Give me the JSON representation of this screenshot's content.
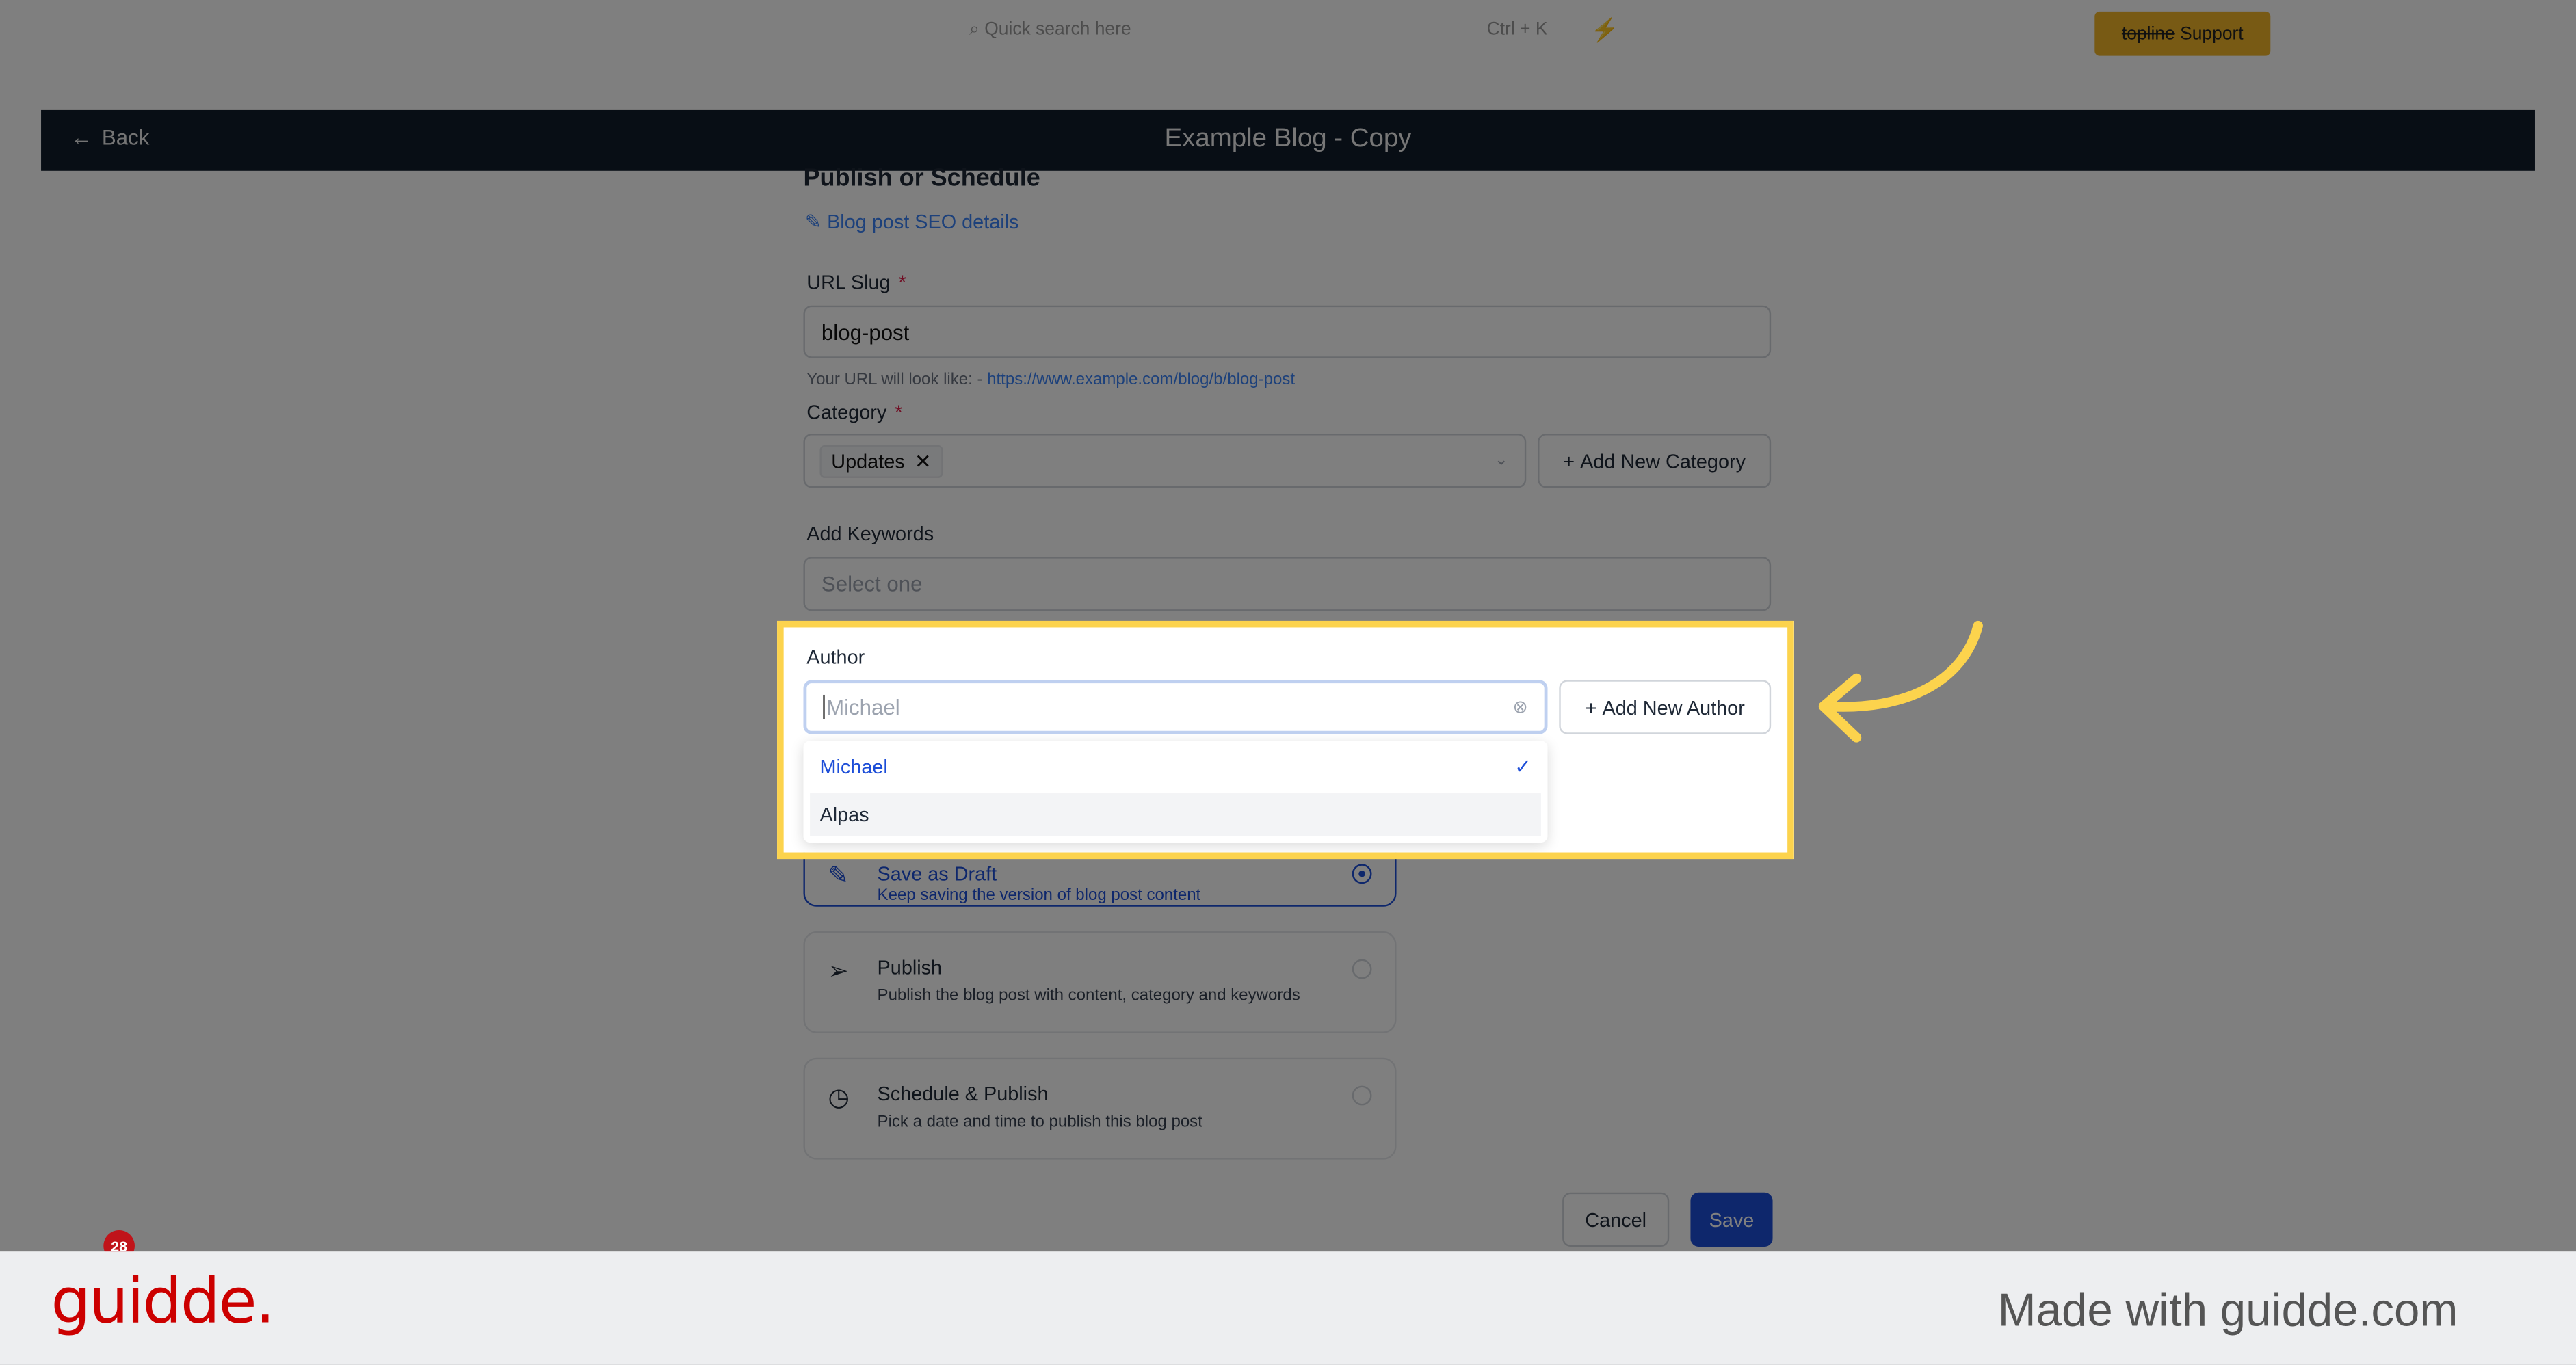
{
  "topbar": {
    "search_placeholder": "Quick search here",
    "shortcut": "Ctrl + K",
    "support_brand": "topline",
    "support_label": "Support"
  },
  "header": {
    "back_label": "Back",
    "title": "Example Blog - Copy"
  },
  "form": {
    "section_title": "Publish or Schedule",
    "seo_link": "Blog post SEO details",
    "url_slug": {
      "label": "URL Slug",
      "required": "*",
      "value": "blog-post",
      "hint": "Your URL will look like: -",
      "hint_url": "https://www.example.com/blog/b/blog-post"
    },
    "category": {
      "label": "Category",
      "required": "*",
      "tags": [
        "Updates"
      ],
      "add_button": "Add New Category"
    },
    "keywords": {
      "label": "Add Keywords",
      "placeholder": "Select one"
    },
    "author": {
      "label": "Author",
      "placeholder": "Michael",
      "add_button": "Add New Author",
      "options": [
        {
          "label": "Michael",
          "selected": true
        },
        {
          "label": "Alpas",
          "selected": false
        }
      ]
    }
  },
  "publish_options": [
    {
      "title": "Save as Draft",
      "description": "Keep saving the version of blog post content",
      "selected": true,
      "icon": "pen-icon"
    },
    {
      "title": "Publish",
      "description": "Publish the blog post with content, category and keywords",
      "selected": false,
      "icon": "send-icon"
    },
    {
      "title": "Schedule & Publish",
      "description": "Pick a date and time to publish this blog post",
      "selected": false,
      "icon": "clock-icon"
    }
  ],
  "actions": {
    "cancel": "Cancel",
    "save": "Save"
  },
  "notification_count": "28",
  "footer": {
    "logo": "guidde.",
    "tagline": "Made with guidde.com"
  },
  "colors": {
    "accent": "#1d4ed8",
    "highlight": "#fcd34d",
    "header": "#101d2b",
    "brand": "#cc0000"
  }
}
